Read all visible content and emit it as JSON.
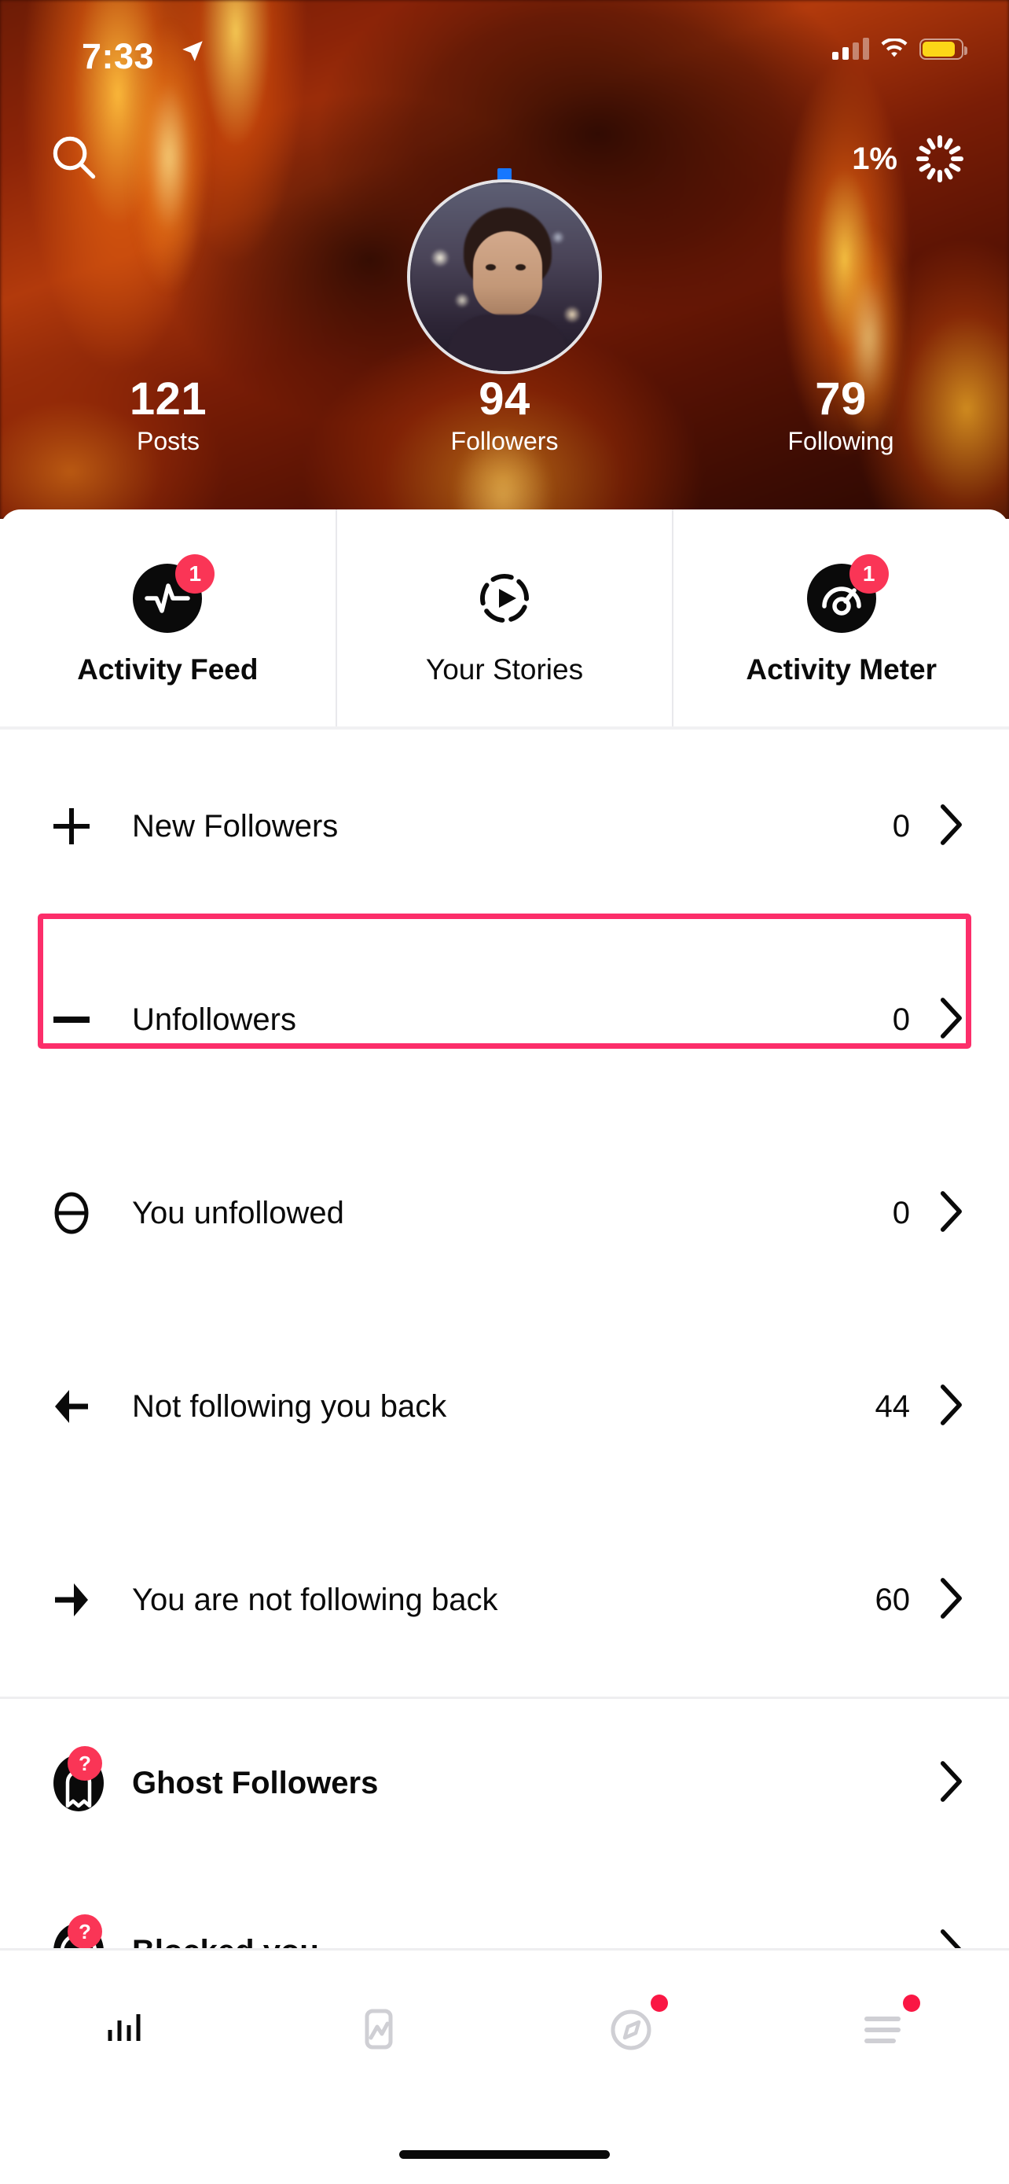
{
  "status_bar": {
    "time": "7:33",
    "location_icon": "location-arrow-icon",
    "signal_icon": "cellular-signal-icon",
    "wifi_icon": "wifi-icon",
    "battery_icon": "battery-low-power-icon",
    "battery_color": "#fcd617"
  },
  "header": {
    "search_icon": "search-icon",
    "sync_percent": "1%",
    "spinner_icon": "loading-spinner-icon",
    "avatar_icon": "profile-avatar",
    "story_indicator": "new-story-indicator"
  },
  "stats": [
    {
      "value": "121",
      "label": "Posts"
    },
    {
      "value": "94",
      "label": "Followers"
    },
    {
      "value": "79",
      "label": "Following"
    }
  ],
  "tabs": [
    {
      "label": "Activity Feed",
      "icon": "pulse-icon",
      "badge": "1",
      "selected": true
    },
    {
      "label": "Your Stories",
      "icon": "play-circle-dashed-icon",
      "badge": "",
      "selected": false
    },
    {
      "label": "Activity Meter",
      "icon": "gauge-icon",
      "badge": "1",
      "selected": true
    }
  ],
  "list": [
    {
      "label": "New Followers",
      "count": "0",
      "icon": "plus-icon",
      "bold": false
    },
    {
      "label": "Unfollowers",
      "count": "0",
      "icon": "minus-icon",
      "bold": false
    },
    {
      "label": "You unfollowed",
      "count": "0",
      "icon": "circle-minus-icon",
      "bold": false
    },
    {
      "label": "Not following you back",
      "count": "44",
      "icon": "arrow-left-icon",
      "bold": false
    },
    {
      "label": "You are not following back",
      "count": "60",
      "icon": "arrow-right-icon",
      "bold": false
    }
  ],
  "locked_list": [
    {
      "label": "Ghost Followers",
      "badge": "?",
      "icon": "ghost-icon",
      "count": ""
    },
    {
      "label": "Blocked you",
      "badge": "?",
      "icon": "prohibition-icon",
      "count": ""
    }
  ],
  "bottom_nav": [
    {
      "icon": "bar-chart-icon",
      "active": true,
      "dot": false
    },
    {
      "icon": "phone-chart-icon",
      "active": false,
      "dot": false
    },
    {
      "icon": "compass-icon",
      "active": false,
      "dot": true
    },
    {
      "icon": "menu-lines-icon",
      "active": false,
      "dot": true
    }
  ],
  "highlight": {
    "target": "Unfollowers",
    "color": "#fc2e6a"
  },
  "colors": {
    "accent_pink": "#fc2e6a",
    "badge_red": "#fa3556",
    "dot_red": "#fa1744",
    "text": "#0a0a0a"
  }
}
